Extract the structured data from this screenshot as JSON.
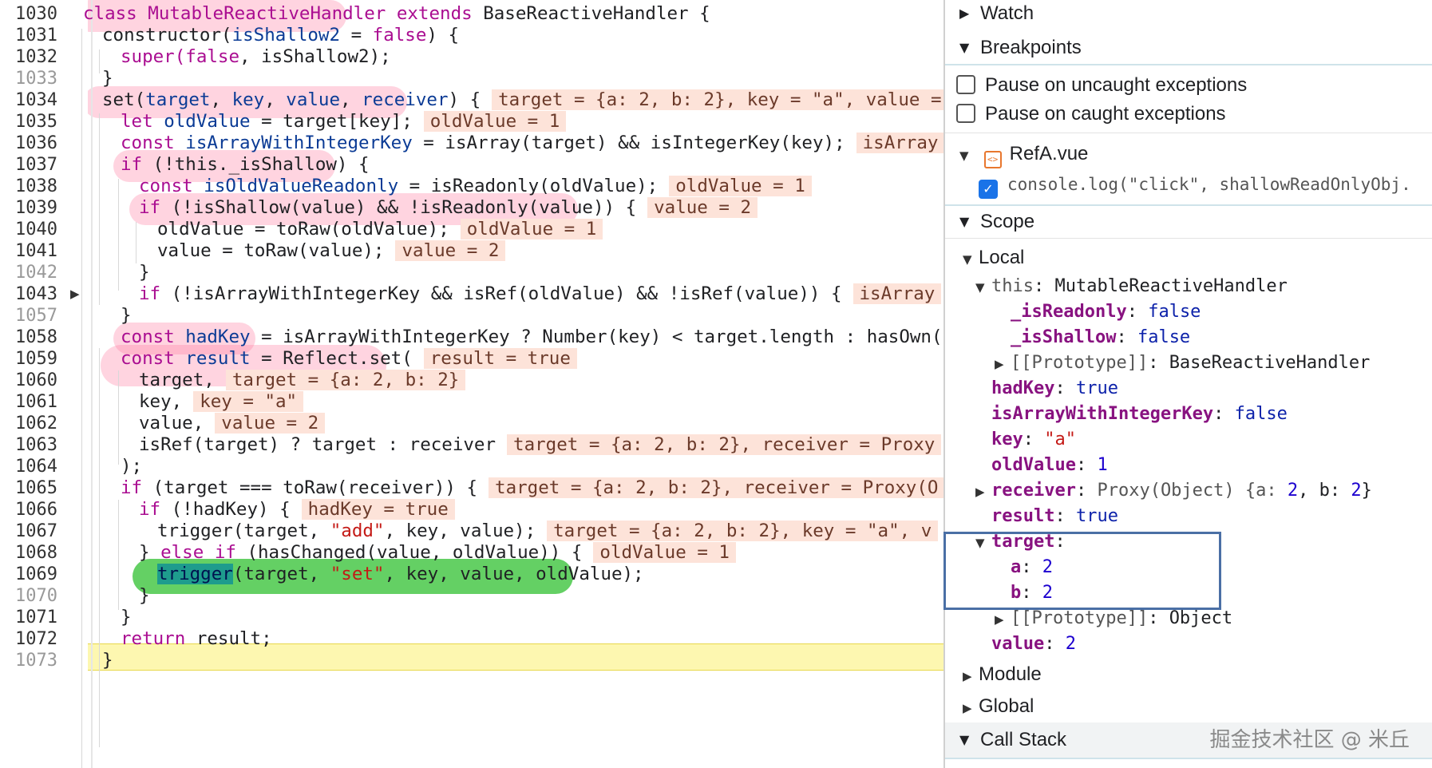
{
  "editor": {
    "gutter": [
      "1030",
      "1031",
      "1032",
      "1033",
      "1034",
      "1035",
      "1036",
      "1037",
      "1038",
      "1039",
      "1040",
      "1041",
      "1042",
      "1043",
      "1057",
      "1058",
      "1059",
      "1060",
      "1061",
      "1062",
      "1063",
      "1064",
      "1065",
      "1066",
      "1067",
      "1068",
      "1069",
      "1070",
      "1071",
      "1072",
      "1073"
    ],
    "lines": {
      "l1030": {
        "a": "class ",
        "b": "MutableReactiveHandler",
        "c": " extends ",
        "d": "BaseReactiveHandler {"
      },
      "l1031": {
        "a": "constructor(",
        "b": "isShallow2",
        "c": " = ",
        "d": "false",
        "e": ") {"
      },
      "l1032": {
        "a": "super(",
        "b": "false",
        "c": ", isShallow2);"
      },
      "l1033": {
        "a": "}"
      },
      "l1034": {
        "a": "set(",
        "b": "target",
        "c": ", ",
        "d": "key",
        "e": ", ",
        "f": "value",
        "g": ", ",
        "h": "receiver",
        "i": ") {",
        "v": "target = {a: 2, b: 2}, key = \"a\", value ="
      },
      "l1035": {
        "a": "let ",
        "b": "oldValue",
        "c": " = target[key];",
        "v": "oldValue = 1"
      },
      "l1036": {
        "a": "const ",
        "b": "isArrayWithIntegerKey",
        "c": " = isArray(target) && isIntegerKey(key);",
        "v": "isArray"
      },
      "l1037": {
        "a": "if ",
        "b": "(!this._isShallow) {"
      },
      "l1038": {
        "a": "const ",
        "b": "isOldValueReadonly",
        "c": " = isReadonly(oldValue);",
        "v": "oldValue = 1"
      },
      "l1039": {
        "a": "if ",
        "b": "(!isShallow(value) && !isReadonly(value)) {",
        "v": "value = 2"
      },
      "l1040": {
        "a": "oldValue = toRaw(oldValue);",
        "v": "oldValue = 1"
      },
      "l1041": {
        "a": "value = toRaw(value);",
        "v": "value = 2"
      },
      "l1042": {
        "a": "}"
      },
      "l1043": {
        "a": "if ",
        "b": "(!isArrayWithIntegerKey && isRef(oldValue) && !isRef(value)) {",
        "v": "isArray"
      },
      "l1057": {
        "a": "}"
      },
      "l1058": {
        "a": "const ",
        "b": "hadKey",
        "c": " = isArrayWithIntegerKey ? Number(key) < target.length : hasOwn("
      },
      "l1059": {
        "a": "const ",
        "b": "result",
        "c": " = Reflect.set(",
        "v": "result = true"
      },
      "l1060": {
        "a": "target,",
        "v": "target = {a: 2, b: 2}"
      },
      "l1061": {
        "a": "key,",
        "v": "key = \"a\""
      },
      "l1062": {
        "a": "value,",
        "v": "value = 2"
      },
      "l1063": {
        "a": "isRef(target) ? target : receiver",
        "v": "target = {a: 2, b: 2}, receiver = Proxy"
      },
      "l1064": {
        "a": ");"
      },
      "l1065": {
        "a": "if ",
        "b": "(target === toRaw(receiver)) {",
        "v": "target = {a: 2, b: 2}, receiver = Proxy(O"
      },
      "l1066": {
        "a": "if ",
        "b": "(!hadKey) {",
        "v": "hadKey = true"
      },
      "l1067": {
        "a": "trigger(target, ",
        "b": "\"add\"",
        "c": ", key, value);",
        "v": "target = {a: 2, b: 2}, key = \"a\", v"
      },
      "l1068": {
        "a": "} ",
        "b": "else if",
        "c": " (hasChanged(value, oldValue)) {",
        "v": "oldValue = 1"
      },
      "l1069": {
        "a": "trigger",
        "b": "(target, ",
        "c": "\"set\"",
        "d": ", key, value, oldValue);"
      },
      "l1070": {
        "a": "}"
      },
      "l1071": {
        "a": "}"
      },
      "l1072": {
        "a": "return ",
        "b": "result;"
      },
      "l1073": {
        "a": "}"
      }
    }
  },
  "sidebar": {
    "watch": "Watch",
    "breakpoints": "Breakpoints",
    "pause_uncaught": "Pause on uncaught exceptions",
    "pause_caught": "Pause on caught exceptions",
    "file_name": "RefA.vue",
    "breakpoint_code": "console.log(\"click\", shallowReadOnlyObj.",
    "scope": "Scope",
    "local": "Local",
    "this_key": "this",
    "this_val": "MutableReactiveHandler",
    "isReadonly_key": "_isReadonly",
    "isReadonly_val": "false",
    "isShallow_key": "_isShallow",
    "isShallow_val": "false",
    "proto1_key": "[[Prototype]]",
    "proto1_val": "BaseReactiveHandler",
    "hadKey_key": "hadKey",
    "hadKey_val": "true",
    "iawik_key": "isArrayWithIntegerKey",
    "iawik_val": "false",
    "key_key": "key",
    "key_val": "\"a\"",
    "oldValue_key": "oldValue",
    "oldValue_val": "1",
    "receiver_key": "receiver",
    "receiver_val_a": "Proxy(Object) {a: ",
    "receiver_val_b": "2",
    "receiver_val_c": ", b: ",
    "receiver_val_d": "2",
    "receiver_val_e": "}",
    "result_key": "result",
    "result_val": "true",
    "target_key": "target",
    "a_key": "a",
    "a_val": "2",
    "b_key": "b",
    "b_val": "2",
    "proto2_key": "[[Prototype]]",
    "proto2_val": "Object",
    "value_key": "value",
    "value_val": "2",
    "module": "Module",
    "global": "Global",
    "call_stack": "Call Stack",
    "watermark": "掘金技术社区 @ 米丘"
  },
  "colors": {
    "execution_line": "#fdf7b0",
    "inline_value_bg": "#fde3d9",
    "annotation_pink": "#ff78a0",
    "annotation_green": "#28be28",
    "annotation_lime": "#c8f032",
    "target_box": "#4a6fa5"
  }
}
